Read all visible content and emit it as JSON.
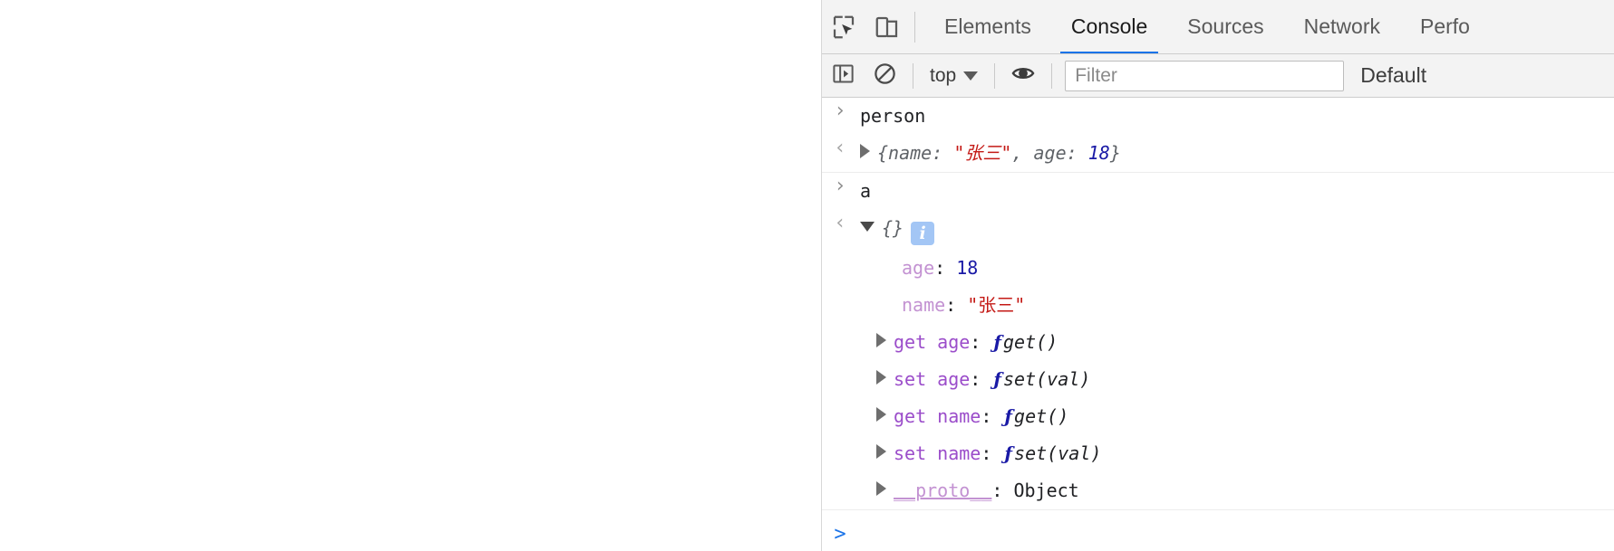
{
  "window": {
    "page_background": "#ffffff"
  },
  "devtools": {
    "tabs": [
      {
        "label": "Elements",
        "active": false
      },
      {
        "label": "Console",
        "active": true
      },
      {
        "label": "Sources",
        "active": false
      },
      {
        "label": "Network",
        "active": false
      },
      {
        "label": "Perfo",
        "active": false
      }
    ],
    "icons": {
      "inspect": "inspect-element-icon",
      "device": "device-toolbar-icon"
    },
    "accent_color": "#1a73e8"
  },
  "console_toolbar": {
    "sidebar_toggle": "console-sidebar-icon",
    "clear_console": "clear-console-icon",
    "context_label": "top",
    "eye_icon": "live-expression-icon",
    "filter_placeholder": "Filter",
    "filter_value": "",
    "level_label": "Default"
  },
  "console": {
    "entries": [
      {
        "kind": "input",
        "text": "person"
      },
      {
        "kind": "output",
        "preview": {
          "open_brace": "{",
          "key": "name",
          "colon": ": ",
          "string_value": "\"张三\"",
          "comma": ", ",
          "key2": "age",
          "colon2": ": ",
          "number_value": "18",
          "close_brace": "}"
        }
      },
      {
        "kind": "input",
        "text": "a"
      },
      {
        "kind": "output_expanded",
        "label": "{}",
        "badge": "i"
      }
    ],
    "properties": [
      {
        "name": "age",
        "separator": ": ",
        "value": "18",
        "value_type": "number",
        "expandable": false
      },
      {
        "name": "name",
        "separator": ": ",
        "value": "\"张三\"",
        "value_type": "string",
        "expandable": false
      },
      {
        "name": "get age",
        "separator": ": ",
        "value": "get()",
        "value_type": "function",
        "expandable": true
      },
      {
        "name": "set age",
        "separator": ": ",
        "value": "set(val)",
        "value_type": "function",
        "expandable": true
      },
      {
        "name": "get name",
        "separator": ": ",
        "value": "get()",
        "value_type": "function",
        "expandable": true
      },
      {
        "name": "set name",
        "separator": ": ",
        "value": "set(val)",
        "value_type": "function",
        "expandable": true
      },
      {
        "name": "__proto__",
        "separator": ": ",
        "value": "Object",
        "value_type": "object",
        "expandable": true
      }
    ],
    "prompt_caret": ">"
  }
}
